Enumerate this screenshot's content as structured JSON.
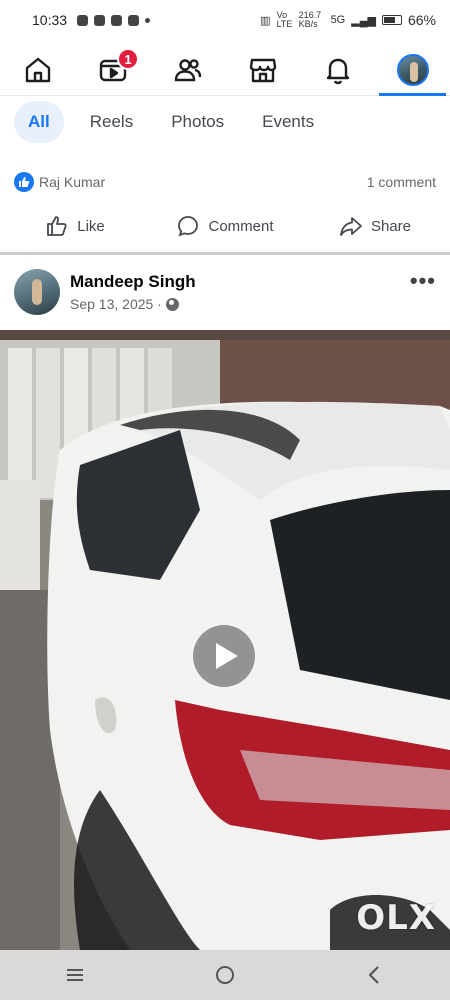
{
  "status_bar": {
    "time": "10:33",
    "network_text": "Vo LTE",
    "speed": "216.7 KB/s",
    "signal": "5G",
    "battery": "66%"
  },
  "top_nav": {
    "items": [
      {
        "name": "home",
        "icon": "home-icon"
      },
      {
        "name": "video",
        "icon": "video-icon",
        "badge": "1"
      },
      {
        "name": "friends",
        "icon": "friends-icon"
      },
      {
        "name": "marketplace",
        "icon": "marketplace-icon"
      },
      {
        "name": "notifications",
        "icon": "bell-icon"
      },
      {
        "name": "profile",
        "icon": "avatar",
        "active": true
      }
    ],
    "active_color": "#1877f2",
    "badge_color": "#e41e3f"
  },
  "filters": {
    "tabs": [
      "All",
      "Reels",
      "Photos",
      "Events"
    ],
    "active": "All"
  },
  "previous_post": {
    "reactor": "Raj Kumar",
    "comment_count": "1 comment",
    "actions": {
      "like": "Like",
      "comment": "Comment",
      "share": "Share"
    }
  },
  "post": {
    "author": "Mandeep Singh",
    "date": "Sep 13, 2025 ·",
    "privacy_icon": "globe-icon",
    "more_icon": "more-icon",
    "media": {
      "type": "video",
      "watermark": "OLX"
    }
  },
  "system_nav": {
    "buttons": [
      "recents-icon",
      "home-circle-icon",
      "back-icon"
    ]
  }
}
